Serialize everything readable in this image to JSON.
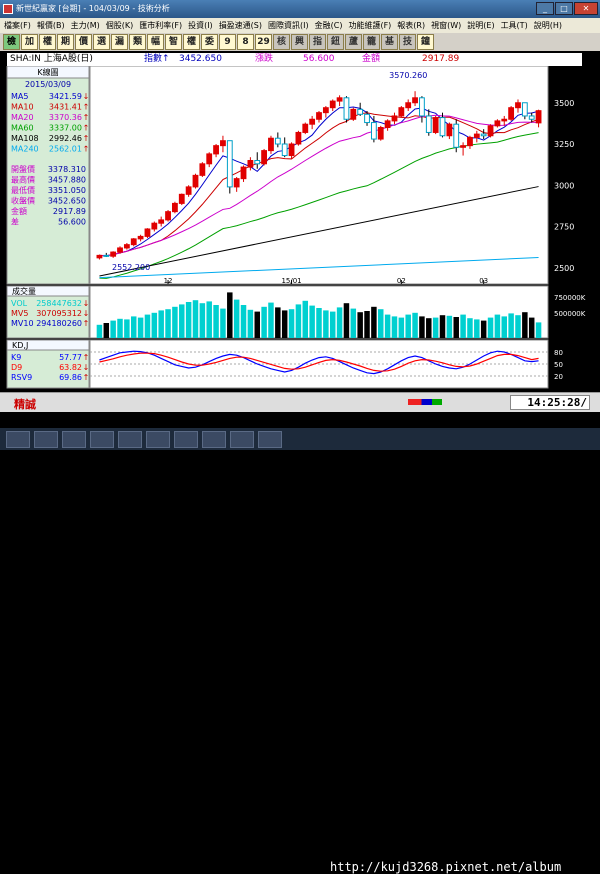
{
  "window": {
    "title": "新世紀贏家 [台期] - 104/03/09 - 技術分析"
  },
  "menu": [
    "檔案(F)",
    "報價(B)",
    "主力(M)",
    "個股(K)",
    "匯市利率(F)",
    "投資(I)",
    "損盈速通(S)",
    "國際資訊(I)",
    "金融(C)",
    "功能維護(F)",
    "報表(R)",
    "視窗(W)",
    "說明(E)",
    "工具(T)",
    "說明(H)"
  ],
  "toolbar": [
    "檢",
    "加",
    "權",
    "期",
    "價",
    "選",
    "漏",
    "類",
    "幅",
    "智",
    "權",
    "委",
    "9",
    "8",
    "29",
    "核",
    "興",
    "指",
    "鈕",
    "蘆",
    "籠",
    "基",
    "技",
    "鐘"
  ],
  "status": {
    "symbol": "SHA:IN 上海A股(日)",
    "index_label": "指數↑",
    "index_value": "3452.650",
    "change_label": "漲跌",
    "change_value": "56.600",
    "amount_label": "金額",
    "amount_value": "2917.89"
  },
  "colors": {
    "up": "#e00000",
    "down": "#00d0d0",
    "ma5": "#0000cc",
    "ma10": "#cc0000",
    "ma20": "#cc00cc",
    "ma60": "#00a000",
    "ma108": "#000000",
    "ma240": "#00aaee",
    "panel": "#d6ecd6",
    "bg": "#ffffff",
    "k": "#0000ff",
    "d": "#ff0000"
  },
  "left_panel": {
    "header": "K線圖",
    "date": "2015/03/09",
    "ma": [
      {
        "label": "MA5",
        "value": "3421.59",
        "arrow": "↓",
        "color": "#0000cc"
      },
      {
        "label": "MA10",
        "value": "3431.41",
        "arrow": "↑",
        "color": "#cc0000"
      },
      {
        "label": "MA20",
        "value": "3370.36",
        "arrow": "↑",
        "color": "#cc00cc"
      },
      {
        "label": "MA60",
        "value": "3337.00",
        "arrow": "↑",
        "color": "#00a000"
      },
      {
        "label": "MA108",
        "value": "2992.46",
        "arrow": "↑",
        "color": "#000000"
      },
      {
        "label": "MA240",
        "value": "2562.01",
        "arrow": "↑",
        "color": "#00aaee"
      }
    ],
    "quote": [
      {
        "label": "開盤價",
        "value": "3378.310"
      },
      {
        "label": "最高價",
        "value": "3457.880"
      },
      {
        "label": "最低價",
        "value": "3351.050"
      },
      {
        "label": "收盤價",
        "value": "3452.650"
      },
      {
        "label": "金額",
        "value": "2917.89"
      },
      {
        "label": "差",
        "value": "56.600"
      }
    ],
    "vol_header": "成交量",
    "vol": [
      {
        "label": "VOL",
        "value": "258447632",
        "arrow": "↓",
        "color": "#00cccc"
      },
      {
        "label": "MV5",
        "value": "307095312",
        "arrow": "↓",
        "color": "#cc0000"
      },
      {
        "label": "MV10",
        "value": "294180260",
        "arrow": "↑",
        "color": "#0000cc"
      }
    ],
    "kd_header": "KD,J",
    "kd": [
      {
        "label": "K9",
        "value": "57.77",
        "arrow": "↑",
        "color": "#0000ff"
      },
      {
        "label": "D9",
        "value": "63.82",
        "arrow": "↓",
        "color": "#ff0000"
      },
      {
        "label": "RSV9",
        "value": "69.86",
        "arrow": "↑",
        "color": "#0000ff"
      }
    ]
  },
  "chart_data": {
    "type": "candlestick",
    "price_axis": {
      "min": 2450,
      "max": 3650,
      "ticks": [
        "3500",
        "3250",
        "3000",
        "2750",
        "2500"
      ]
    },
    "x_ticks": [
      "12",
      "15/01",
      "02",
      "03"
    ],
    "annotations": {
      "high": "3570.260",
      "low": "2552.200"
    },
    "candles": [
      [
        2560,
        2580,
        2550,
        2575
      ],
      [
        2575,
        2590,
        2565,
        2570
      ],
      [
        2570,
        2600,
        2560,
        2595
      ],
      [
        2595,
        2630,
        2585,
        2620
      ],
      [
        2620,
        2650,
        2610,
        2640
      ],
      [
        2640,
        2680,
        2630,
        2675
      ],
      [
        2675,
        2700,
        2660,
        2690
      ],
      [
        2690,
        2740,
        2680,
        2735
      ],
      [
        2735,
        2780,
        2720,
        2770
      ],
      [
        2770,
        2810,
        2750,
        2790
      ],
      [
        2790,
        2850,
        2780,
        2840
      ],
      [
        2840,
        2900,
        2830,
        2890
      ],
      [
        2890,
        2950,
        2880,
        2945
      ],
      [
        2945,
        3000,
        2930,
        2990
      ],
      [
        2990,
        3070,
        2980,
        3060
      ],
      [
        3060,
        3140,
        3050,
        3130
      ],
      [
        3130,
        3200,
        3110,
        3190
      ],
      [
        3190,
        3250,
        3170,
        3240
      ],
      [
        3240,
        3300,
        3200,
        3270
      ],
      [
        3270,
        3250,
        2950,
        2990
      ],
      [
        2990,
        3050,
        2960,
        3040
      ],
      [
        3040,
        3120,
        3020,
        3110
      ],
      [
        3110,
        3170,
        3090,
        3150
      ],
      [
        3150,
        3200,
        3100,
        3130
      ],
      [
        3130,
        3220,
        3120,
        3210
      ],
      [
        3210,
        3300,
        3190,
        3285
      ],
      [
        3285,
        3320,
        3230,
        3250
      ],
      [
        3250,
        3290,
        3170,
        3180
      ],
      [
        3180,
        3260,
        3160,
        3250
      ],
      [
        3250,
        3330,
        3240,
        3320
      ],
      [
        3320,
        3380,
        3310,
        3370
      ],
      [
        3370,
        3420,
        3340,
        3400
      ],
      [
        3400,
        3450,
        3380,
        3440
      ],
      [
        3440,
        3480,
        3410,
        3470
      ],
      [
        3470,
        3520,
        3450,
        3510
      ],
      [
        3510,
        3545,
        3480,
        3530
      ],
      [
        3530,
        3540,
        3380,
        3400
      ],
      [
        3400,
        3470,
        3390,
        3460
      ],
      [
        3460,
        3500,
        3420,
        3430
      ],
      [
        3430,
        3450,
        3360,
        3380
      ],
      [
        3380,
        3420,
        3260,
        3280
      ],
      [
        3280,
        3360,
        3270,
        3350
      ],
      [
        3350,
        3400,
        3330,
        3390
      ],
      [
        3390,
        3440,
        3370,
        3420
      ],
      [
        3420,
        3480,
        3410,
        3470
      ],
      [
        3470,
        3520,
        3450,
        3500
      ],
      [
        3500,
        3570,
        3480,
        3530
      ],
      [
        3530,
        3540,
        3380,
        3420
      ],
      [
        3420,
        3460,
        3300,
        3320
      ],
      [
        3320,
        3420,
        3310,
        3410
      ],
      [
        3410,
        3440,
        3290,
        3300
      ],
      [
        3300,
        3380,
        3280,
        3370
      ],
      [
        3370,
        3400,
        3200,
        3230
      ],
      [
        3230,
        3260,
        3180,
        3240
      ],
      [
        3240,
        3300,
        3220,
        3290
      ],
      [
        3290,
        3330,
        3260,
        3310
      ],
      [
        3310,
        3340,
        3280,
        3300
      ],
      [
        3300,
        3370,
        3290,
        3360
      ],
      [
        3360,
        3400,
        3350,
        3390
      ],
      [
        3390,
        3420,
        3360,
        3400
      ],
      [
        3400,
        3480,
        3390,
        3470
      ],
      [
        3470,
        3520,
        3440,
        3500
      ],
      [
        3500,
        3500,
        3400,
        3420
      ],
      [
        3420,
        3440,
        3380,
        3400
      ],
      [
        3378,
        3458,
        3351,
        3452
      ]
    ],
    "volume": [
      2.2,
      2.5,
      2.9,
      3.2,
      3.1,
      3.6,
      3.4,
      3.9,
      4.2,
      4.6,
      4.8,
      5.2,
      5.6,
      6.0,
      6.3,
      5.8,
      6.1,
      5.5,
      4.9,
      7.6,
      6.4,
      5.5,
      4.7,
      4.4,
      5.2,
      5.9,
      5.1,
      4.6,
      4.8,
      5.6,
      6.2,
      5.4,
      5.0,
      4.6,
      4.4,
      5.1,
      5.8,
      4.9,
      4.3,
      4.5,
      5.2,
      4.8,
      3.9,
      3.6,
      3.4,
      3.9,
      4.2,
      3.6,
      3.3,
      3.4,
      3.8,
      3.7,
      3.5,
      3.9,
      3.3,
      3.1,
      2.9,
      3.4,
      3.9,
      3.6,
      4.1,
      3.8,
      4.3,
      3.4,
      2.6
    ],
    "vol_axis": {
      "max": 800000000,
      "ticks": [
        "750000K",
        "500000K"
      ]
    },
    "kd_axis": {
      "ticks": [
        "80",
        "50",
        "20"
      ]
    },
    "k": [
      60,
      66,
      72,
      78,
      80,
      82,
      81,
      78,
      72,
      64,
      56,
      48,
      44,
      40,
      42,
      48,
      56,
      64,
      70,
      74,
      72,
      66,
      58,
      50,
      44,
      38,
      34,
      30,
      34,
      42,
      52,
      60,
      66,
      68,
      64,
      56,
      48,
      40,
      34,
      28,
      26,
      30,
      38,
      48,
      58,
      66,
      70,
      66,
      58,
      50,
      44,
      40,
      38,
      42,
      50,
      60,
      70,
      78,
      82,
      80,
      74,
      66,
      58,
      56,
      58
    ],
    "d": [
      55,
      59,
      63,
      68,
      72,
      75,
      77,
      77,
      76,
      72,
      67,
      61,
      55,
      50,
      47,
      47,
      50,
      54,
      59,
      64,
      67,
      67,
      64,
      59,
      54,
      49,
      44,
      39,
      37,
      38,
      42,
      48,
      54,
      59,
      61,
      59,
      55,
      50,
      45,
      39,
      34,
      32,
      33,
      37,
      44,
      52,
      58,
      61,
      60,
      57,
      53,
      48,
      44,
      43,
      45,
      50,
      57,
      64,
      71,
      74,
      74,
      71,
      66,
      61,
      64
    ]
  },
  "footer": {
    "brand": "精誠",
    "clock": "14:25:28/"
  },
  "watermark": "http://kujd3268.pixnet.net/album"
}
